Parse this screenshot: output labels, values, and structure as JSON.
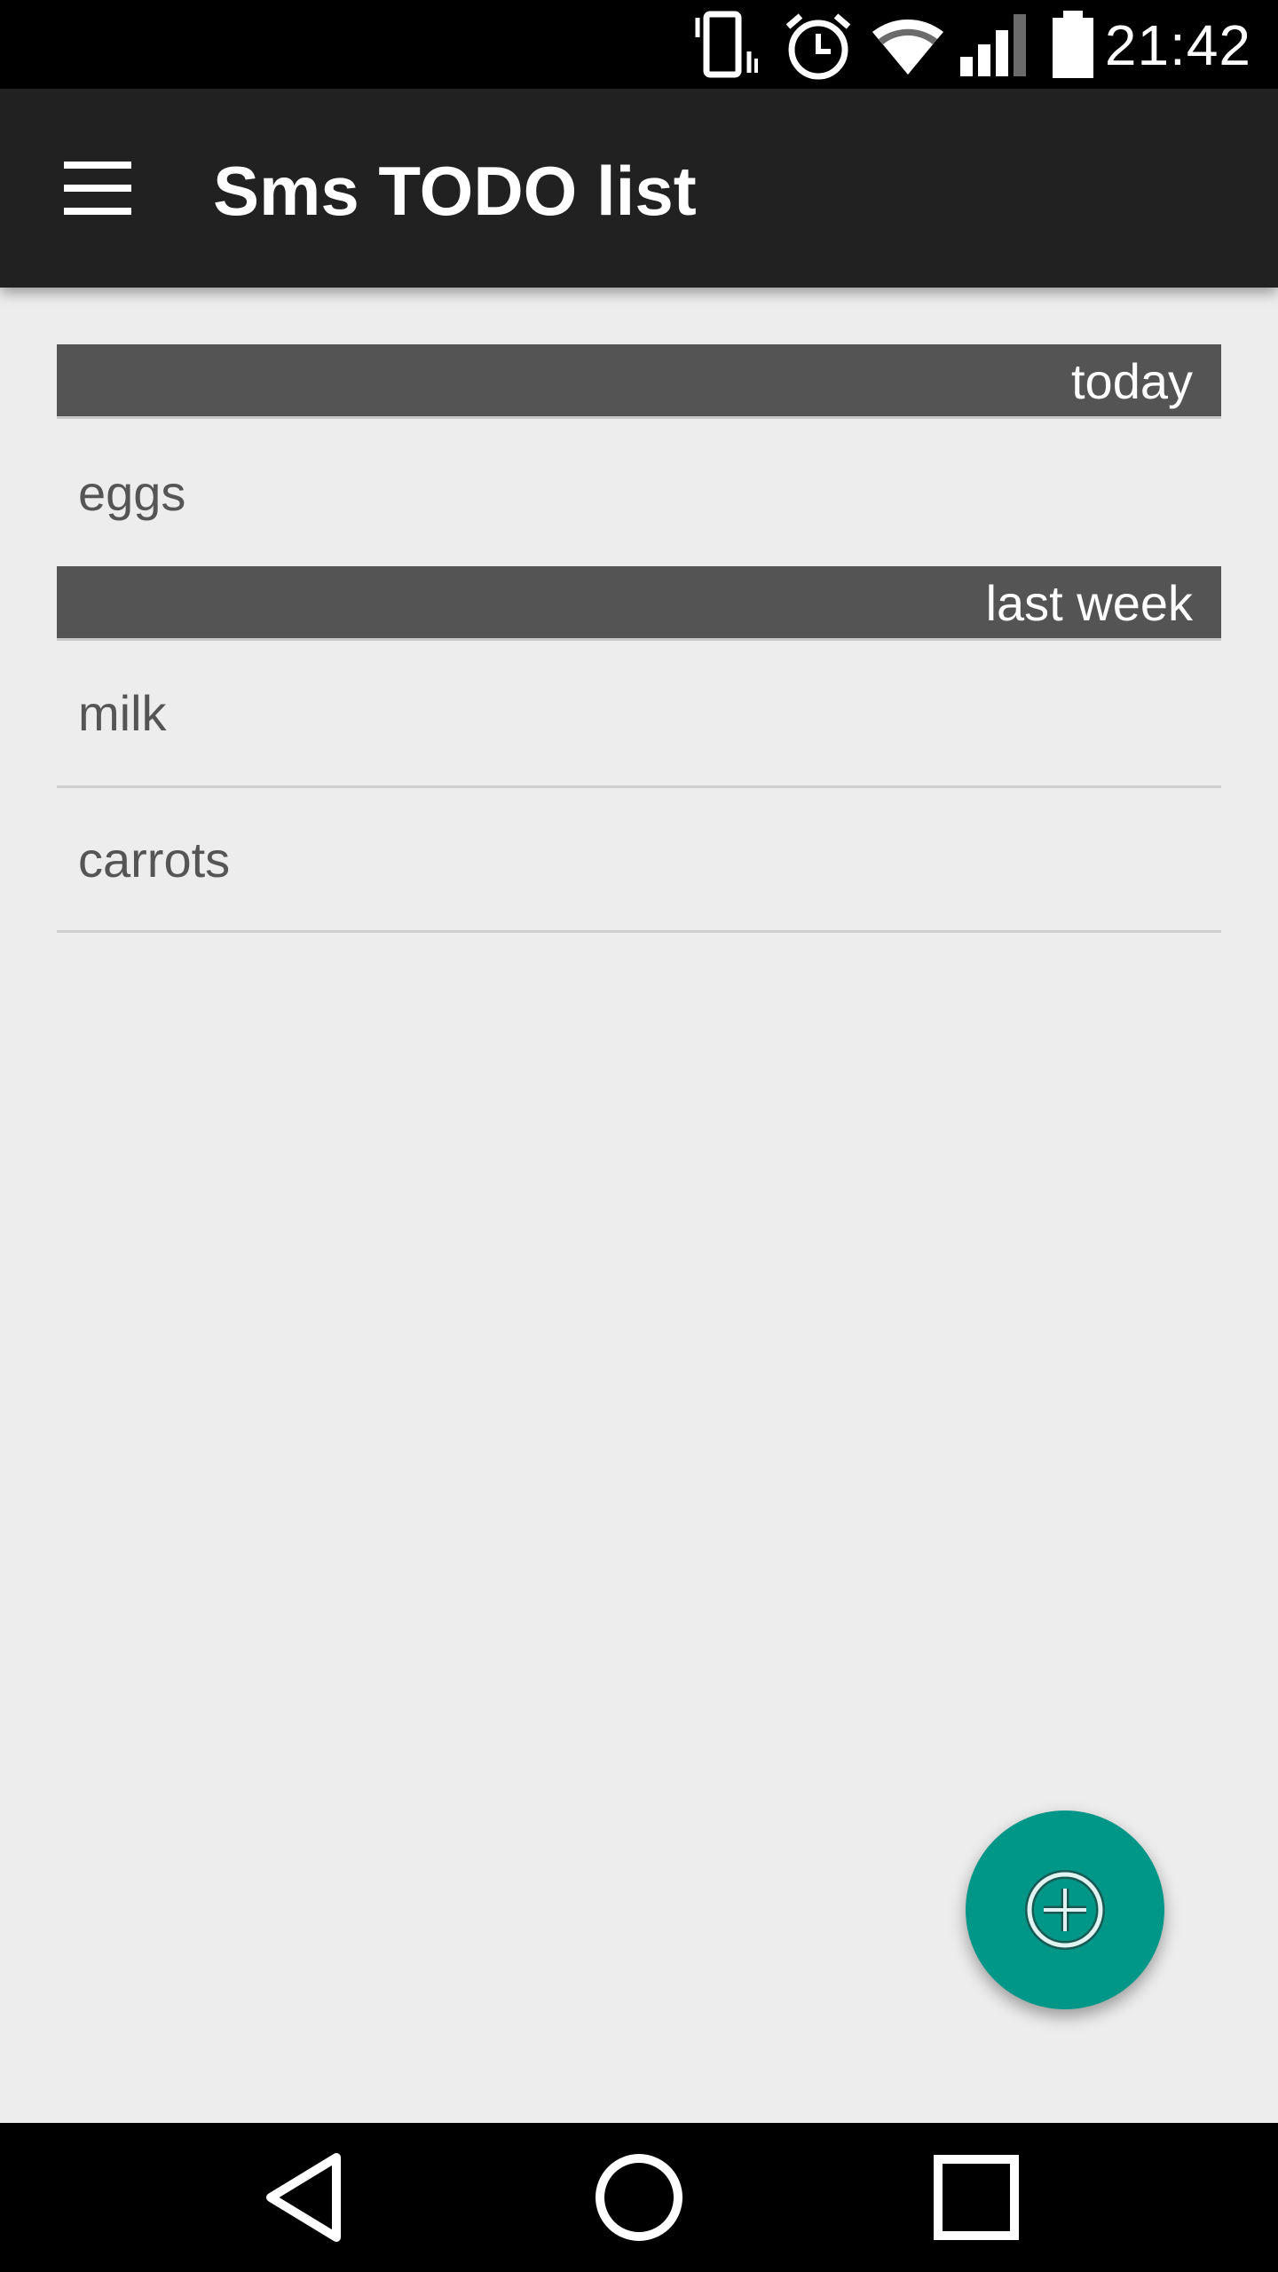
{
  "status_bar": {
    "time": "21:42",
    "icons": [
      "vibrate-icon",
      "alarm-icon",
      "wifi-icon",
      "signal-icon",
      "battery-icon"
    ]
  },
  "app_bar": {
    "title": "Sms TODO list",
    "menu_icon": "hamburger-menu-icon"
  },
  "sections": [
    {
      "header": "today",
      "items": [
        "eggs"
      ]
    },
    {
      "header": "last week",
      "items": [
        "milk",
        "carrots"
      ]
    }
  ],
  "fab": {
    "icon": "add-circle-icon",
    "color": "#009688"
  },
  "nav_bar": {
    "icons": [
      "back-icon",
      "home-icon",
      "recents-icon"
    ]
  },
  "colors": {
    "app_bar": "#212121",
    "section_header": "#545454",
    "background": "#ededed",
    "accent": "#009688"
  }
}
